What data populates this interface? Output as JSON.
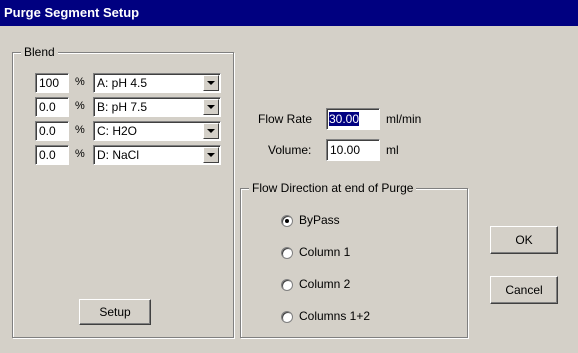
{
  "window": {
    "title": "Purge Segment Setup"
  },
  "blend": {
    "label": "Blend",
    "percent_symbol": "%",
    "rows": [
      {
        "percent": "100",
        "solvent": "A: pH 4.5"
      },
      {
        "percent": "0.0",
        "solvent": "B: pH 7.5"
      },
      {
        "percent": "0.0",
        "solvent": "C: H2O"
      },
      {
        "percent": "0.0",
        "solvent": "D: NaCl"
      }
    ],
    "setup_label": "Setup"
  },
  "flow_rate": {
    "label": "Flow Rate",
    "value": "30.00",
    "unit": "ml/min"
  },
  "volume": {
    "label": "Volume:",
    "value": "10.00",
    "unit": "ml"
  },
  "flow_direction": {
    "label": "Flow Direction at end of Purge",
    "options": [
      "ByPass",
      "Column 1",
      "Column 2",
      "Columns 1+2"
    ],
    "selected": "ByPass"
  },
  "buttons": {
    "ok": "OK",
    "cancel": "Cancel"
  },
  "colors": {
    "titlebar": "#000080",
    "face": "#d4d0c8",
    "selection": "#000080"
  }
}
